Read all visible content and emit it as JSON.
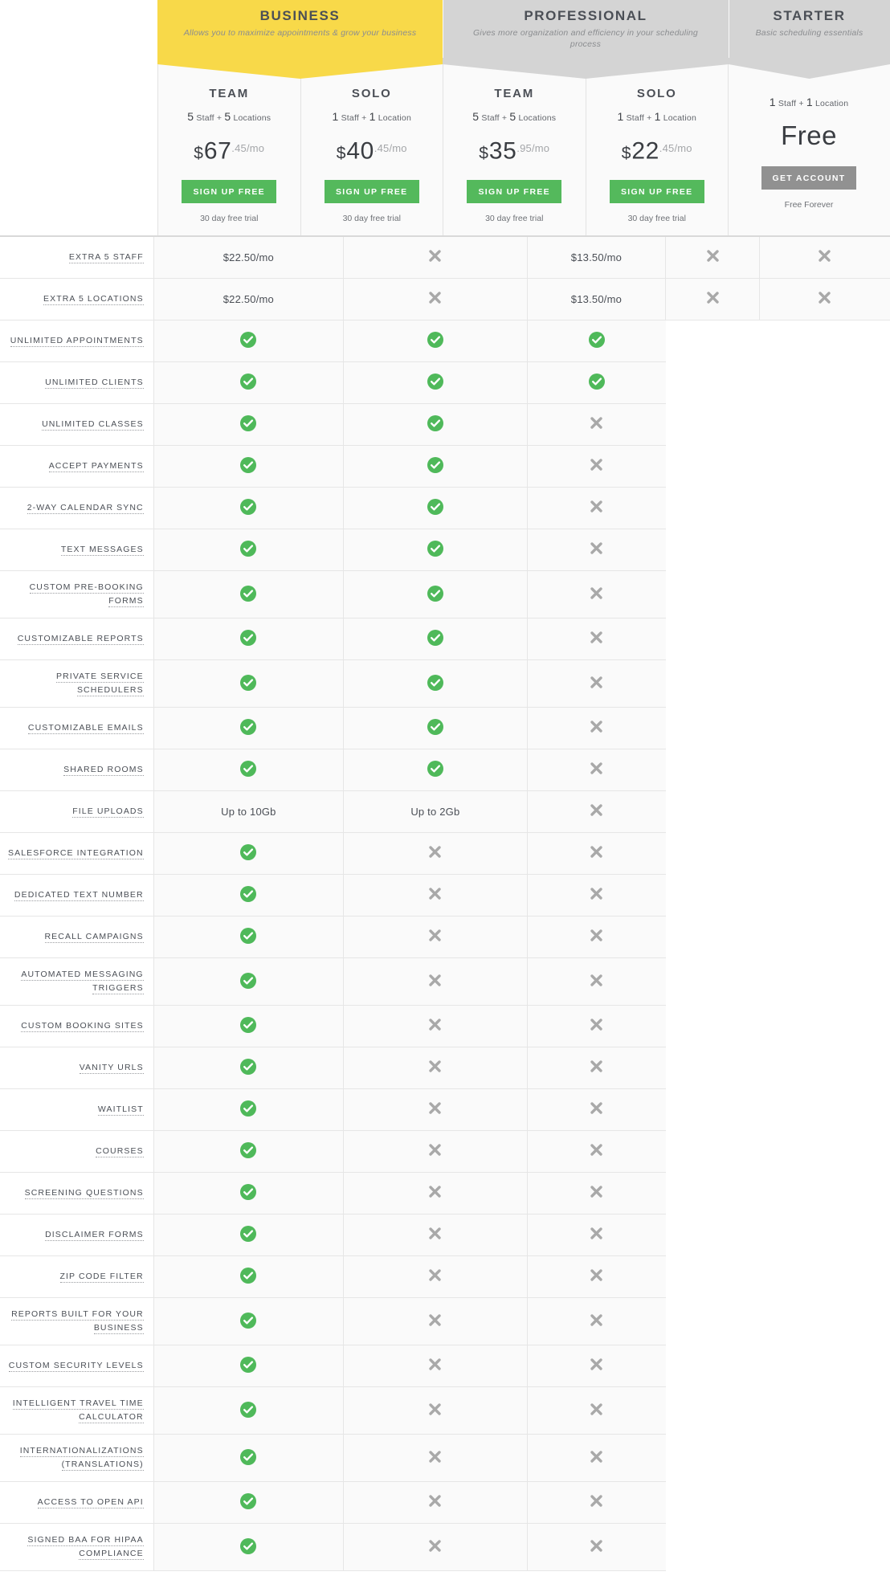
{
  "colors": {
    "business_banner": "#f8d949",
    "other_banner": "#d4d4d4",
    "cta_green": "#54b95c",
    "cta_grey": "#919191",
    "check_green": "#4fb95a",
    "cross_grey": "#a9a9a9"
  },
  "banners": [
    {
      "title": "BUSINESS",
      "subtitle": "Allows you to maximize appointments & grow your business"
    },
    {
      "title": "PROFESSIONAL",
      "subtitle": "Gives more organization and efficiency in your scheduling process"
    },
    {
      "title": "STARTER",
      "subtitle": "Basic scheduling essentials"
    }
  ],
  "plans": [
    {
      "name": "TEAM",
      "qty_staff": "5",
      "qty_staff_word": "Staff",
      "plus": "+",
      "qty_loc": "5",
      "qty_loc_word": "Locations",
      "currency": "$",
      "price_int": "67",
      "price_dec": ".45/mo",
      "button": "SIGN UP FREE",
      "note": "30 day free trial"
    },
    {
      "name": "SOLO",
      "qty_staff": "1",
      "qty_staff_word": "Staff",
      "plus": "+",
      "qty_loc": "1",
      "qty_loc_word": "Location",
      "currency": "$",
      "price_int": "40",
      "price_dec": ".45/mo",
      "button": "SIGN UP FREE",
      "note": "30 day free trial"
    },
    {
      "name": "TEAM",
      "qty_staff": "5",
      "qty_staff_word": "Staff",
      "plus": "+",
      "qty_loc": "5",
      "qty_loc_word": "Locations",
      "currency": "$",
      "price_int": "35",
      "price_dec": ".95/mo",
      "button": "SIGN UP FREE",
      "note": "30 day free trial"
    },
    {
      "name": "SOLO",
      "qty_staff": "1",
      "qty_staff_word": "Staff",
      "plus": "+",
      "qty_loc": "1",
      "qty_loc_word": "Location",
      "currency": "$",
      "price_int": "22",
      "price_dec": ".45/mo",
      "button": "SIGN UP FREE",
      "note": "30 day free trial"
    },
    {
      "name": "",
      "qty_staff": "1",
      "qty_staff_word": "Staff",
      "plus": "+",
      "qty_loc": "1",
      "qty_loc_word": "Location",
      "currency": "",
      "price_int": "Free",
      "price_dec": "",
      "button": "GET ACCOUNT",
      "note": "Free Forever"
    }
  ],
  "icons": {
    "check": "check-circle-icon",
    "cross": "cross-icon"
  },
  "features": [
    {
      "label": "EXTRA 5 STAFF",
      "split": true,
      "cells": [
        {
          "type": "text",
          "value": "$22.50/mo"
        },
        {
          "type": "cross"
        },
        {
          "type": "text",
          "value": "$13.50/mo"
        },
        {
          "type": "cross"
        },
        {
          "type": "cross"
        }
      ]
    },
    {
      "label": "EXTRA 5 LOCATIONS",
      "split": true,
      "cells": [
        {
          "type": "text",
          "value": "$22.50/mo"
        },
        {
          "type": "cross"
        },
        {
          "type": "text",
          "value": "$13.50/mo"
        },
        {
          "type": "cross"
        },
        {
          "type": "cross"
        }
      ]
    },
    {
      "label": "UNLIMITED APPOINTMENTS",
      "split": false,
      "cells": [
        {
          "type": "check"
        },
        {
          "type": "check"
        },
        {
          "type": "check"
        }
      ]
    },
    {
      "label": "UNLIMITED CLIENTS",
      "split": false,
      "cells": [
        {
          "type": "check"
        },
        {
          "type": "check"
        },
        {
          "type": "check"
        }
      ]
    },
    {
      "label": "UNLIMITED CLASSES",
      "split": false,
      "cells": [
        {
          "type": "check"
        },
        {
          "type": "check"
        },
        {
          "type": "cross"
        }
      ]
    },
    {
      "label": "ACCEPT PAYMENTS",
      "split": false,
      "cells": [
        {
          "type": "check"
        },
        {
          "type": "check"
        },
        {
          "type": "cross"
        }
      ]
    },
    {
      "label": "2-WAY CALENDAR SYNC",
      "split": false,
      "cells": [
        {
          "type": "check"
        },
        {
          "type": "check"
        },
        {
          "type": "cross"
        }
      ]
    },
    {
      "label": "TEXT MESSAGES",
      "split": false,
      "cells": [
        {
          "type": "check"
        },
        {
          "type": "check"
        },
        {
          "type": "cross"
        }
      ]
    },
    {
      "label": "CUSTOM PRE-BOOKING FORMS",
      "split": false,
      "cells": [
        {
          "type": "check"
        },
        {
          "type": "check"
        },
        {
          "type": "cross"
        }
      ]
    },
    {
      "label": "CUSTOMIZABLE REPORTS",
      "split": false,
      "cells": [
        {
          "type": "check"
        },
        {
          "type": "check"
        },
        {
          "type": "cross"
        }
      ]
    },
    {
      "label": "PRIVATE SERVICE SCHEDULERS",
      "split": false,
      "cells": [
        {
          "type": "check"
        },
        {
          "type": "check"
        },
        {
          "type": "cross"
        }
      ]
    },
    {
      "label": "CUSTOMIZABLE EMAILS",
      "split": false,
      "cells": [
        {
          "type": "check"
        },
        {
          "type": "check"
        },
        {
          "type": "cross"
        }
      ]
    },
    {
      "label": "SHARED ROOMS",
      "split": false,
      "cells": [
        {
          "type": "check"
        },
        {
          "type": "check"
        },
        {
          "type": "cross"
        }
      ]
    },
    {
      "label": "FILE UPLOADS",
      "split": false,
      "cells": [
        {
          "type": "text",
          "value": "Up to 10Gb"
        },
        {
          "type": "text",
          "value": "Up to 2Gb"
        },
        {
          "type": "cross"
        }
      ]
    },
    {
      "label": "SALESFORCE INTEGRATION",
      "split": false,
      "cells": [
        {
          "type": "check"
        },
        {
          "type": "cross"
        },
        {
          "type": "cross"
        }
      ]
    },
    {
      "label": "DEDICATED TEXT NUMBER",
      "split": false,
      "cells": [
        {
          "type": "check"
        },
        {
          "type": "cross"
        },
        {
          "type": "cross"
        }
      ]
    },
    {
      "label": "RECALL CAMPAIGNS",
      "split": false,
      "cells": [
        {
          "type": "check"
        },
        {
          "type": "cross"
        },
        {
          "type": "cross"
        }
      ]
    },
    {
      "label": "AUTOMATED MESSAGING TRIGGERS",
      "split": false,
      "cells": [
        {
          "type": "check"
        },
        {
          "type": "cross"
        },
        {
          "type": "cross"
        }
      ]
    },
    {
      "label": "CUSTOM BOOKING SITES",
      "split": false,
      "cells": [
        {
          "type": "check"
        },
        {
          "type": "cross"
        },
        {
          "type": "cross"
        }
      ]
    },
    {
      "label": "VANITY URLS",
      "split": false,
      "cells": [
        {
          "type": "check"
        },
        {
          "type": "cross"
        },
        {
          "type": "cross"
        }
      ]
    },
    {
      "label": "WAITLIST",
      "split": false,
      "cells": [
        {
          "type": "check"
        },
        {
          "type": "cross"
        },
        {
          "type": "cross"
        }
      ]
    },
    {
      "label": "COURSES",
      "split": false,
      "cells": [
        {
          "type": "check"
        },
        {
          "type": "cross"
        },
        {
          "type": "cross"
        }
      ]
    },
    {
      "label": "SCREENING QUESTIONS",
      "split": false,
      "cells": [
        {
          "type": "check"
        },
        {
          "type": "cross"
        },
        {
          "type": "cross"
        }
      ]
    },
    {
      "label": "DISCLAIMER FORMS",
      "split": false,
      "cells": [
        {
          "type": "check"
        },
        {
          "type": "cross"
        },
        {
          "type": "cross"
        }
      ]
    },
    {
      "label": "ZIP CODE FILTER",
      "split": false,
      "cells": [
        {
          "type": "check"
        },
        {
          "type": "cross"
        },
        {
          "type": "cross"
        }
      ]
    },
    {
      "label": "REPORTS BUILT FOR YOUR BUSINESS",
      "split": false,
      "cells": [
        {
          "type": "check"
        },
        {
          "type": "cross"
        },
        {
          "type": "cross"
        }
      ]
    },
    {
      "label": "CUSTOM SECURITY LEVELS",
      "split": false,
      "cells": [
        {
          "type": "check"
        },
        {
          "type": "cross"
        },
        {
          "type": "cross"
        }
      ]
    },
    {
      "label": "INTELLIGENT TRAVEL TIME CALCULATOR",
      "split": false,
      "cells": [
        {
          "type": "check"
        },
        {
          "type": "cross"
        },
        {
          "type": "cross"
        }
      ]
    },
    {
      "label": "INTERNATIONALIZATIONS (TRANSLATIONS)",
      "split": false,
      "cells": [
        {
          "type": "check"
        },
        {
          "type": "cross"
        },
        {
          "type": "cross"
        }
      ]
    },
    {
      "label": "ACCESS TO OPEN API",
      "split": false,
      "cells": [
        {
          "type": "check"
        },
        {
          "type": "cross"
        },
        {
          "type": "cross"
        }
      ]
    },
    {
      "label": "SIGNED BAA FOR HIPAA COMPLIANCE",
      "split": false,
      "cells": [
        {
          "type": "check"
        },
        {
          "type": "cross"
        },
        {
          "type": "cross"
        }
      ]
    }
  ]
}
